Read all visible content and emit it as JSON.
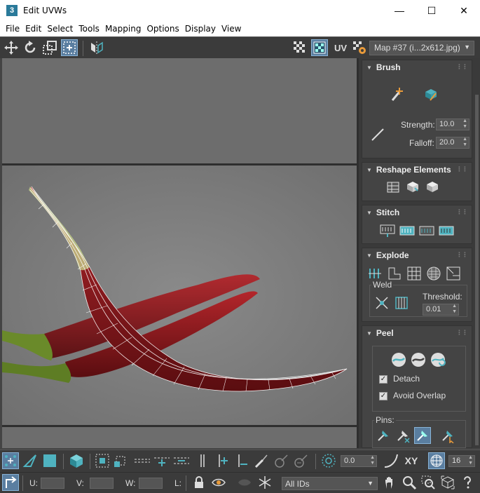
{
  "window": {
    "title": "Edit UVWs",
    "app_icon_label": "3"
  },
  "menu": [
    "File",
    "Edit",
    "Select",
    "Tools",
    "Mapping",
    "Options",
    "Display",
    "View"
  ],
  "toolbar_top": {
    "uv_label": "UV",
    "map_select": "Map #37 (i...2x612.jpg)"
  },
  "brush": {
    "title": "Brush",
    "strength_label": "Strength:",
    "strength_value": "10.0",
    "falloff_label": "Falloff:",
    "falloff_value": "20.0"
  },
  "reshape": {
    "title": "Reshape Elements"
  },
  "stitch": {
    "title": "Stitch"
  },
  "explode": {
    "title": "Explode",
    "weld_label": "Weld",
    "threshold_label": "Threshold:",
    "threshold_value": "0.01"
  },
  "peel": {
    "title": "Peel",
    "detach_label": "Detach",
    "detach_checked": true,
    "avoid_overlap_label": "Avoid Overlap",
    "avoid_overlap_checked": true,
    "pins_label": "Pins:"
  },
  "bottom_toolbar": {
    "angle_value": "0.0",
    "xy_label": "XY",
    "grid_value": "16"
  },
  "status_bar": {
    "u_label": "U:",
    "v_label": "V:",
    "w_label": "W:",
    "l_label": "L:",
    "ids_select": "All IDs"
  },
  "colors": {
    "accent": "#4fb3c0",
    "panel": "#444444",
    "toolbar": "#3b3b3b",
    "viewport": "#6b6b6b",
    "chili": "#8a1a1e"
  }
}
